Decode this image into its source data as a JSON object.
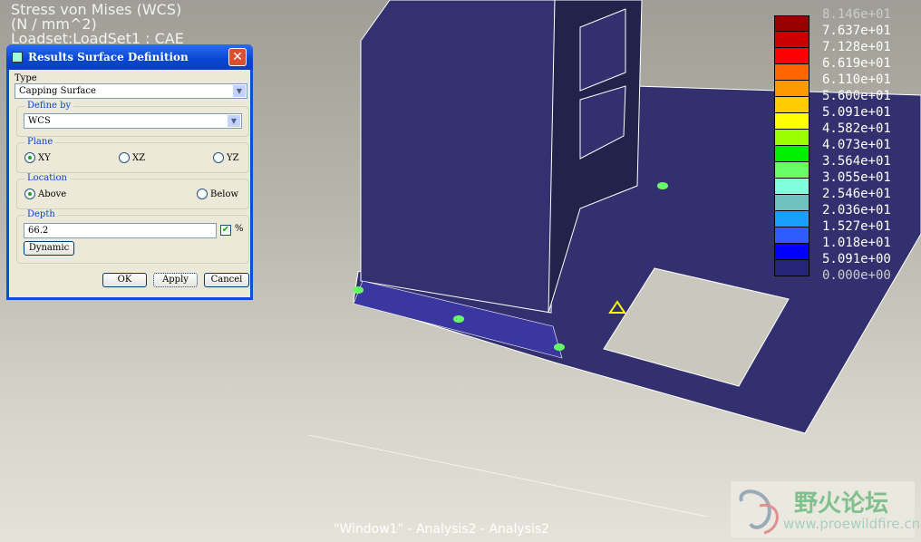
{
  "viewport": {
    "title_lines": [
      "Stress von Mises (WCS)",
      "(N / mm^2)",
      "Loadset:LoadSet1 : CAE"
    ],
    "footer": "\"Window1\" - Analysis2 - Analysis2"
  },
  "dialog": {
    "title": "Results Surface Definition",
    "type_label": "Type",
    "type_value": "Capping Surface",
    "define_by": {
      "label": "Define by",
      "value": "WCS"
    },
    "plane": {
      "label": "Plane",
      "options": [
        "XY",
        "XZ",
        "YZ"
      ],
      "selected": "XY"
    },
    "location": {
      "label": "Location",
      "options": [
        "Above",
        "Below"
      ],
      "selected": "Above"
    },
    "depth": {
      "label": "Depth",
      "value": "66.2",
      "percent_checked": true,
      "percent_label": "%",
      "dynamic_label": "Dynamic"
    },
    "buttons": {
      "ok": "OK",
      "apply": "Apply",
      "cancel": "Cancel"
    }
  },
  "legend": {
    "labels": [
      "8.146e+01",
      "7.637e+01",
      "7.128e+01",
      "6.619e+01",
      "6.110e+01",
      "5.600e+01",
      "5.091e+01",
      "4.582e+01",
      "4.073e+01",
      "3.564e+01",
      "3.055e+01",
      "2.546e+01",
      "2.036e+01",
      "1.527e+01",
      "1.018e+01",
      "5.091e+00",
      "0.000e+00"
    ],
    "colors": [
      "#990000",
      "#cc0000",
      "#ff0000",
      "#ff6600",
      "#ff9900",
      "#ffcc00",
      "#ffff00",
      "#99ff00",
      "#00ee00",
      "#66ff66",
      "#80ffdd",
      "#70c0c0",
      "#19a0ff",
      "#2e5cff",
      "#0000ff",
      "#25257a"
    ]
  },
  "watermark": {
    "text": "野火论坛",
    "url": "www.proewildfire.cn"
  }
}
